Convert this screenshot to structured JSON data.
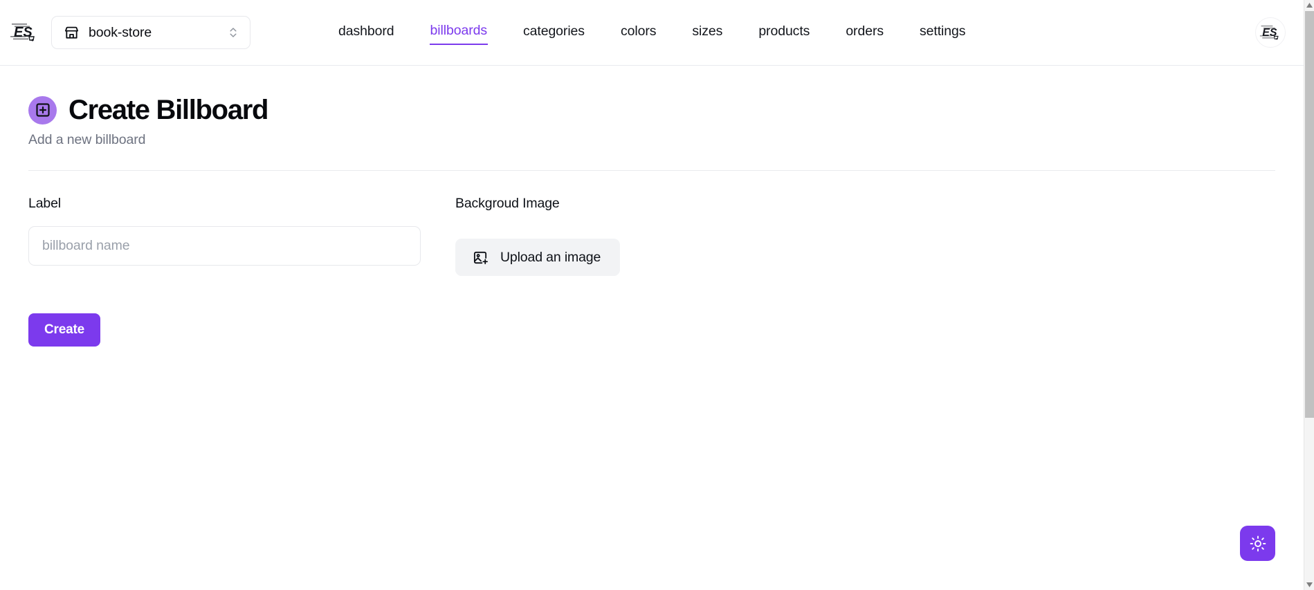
{
  "navbar": {
    "brand_logo_alt": "ES store logo",
    "store_switcher": {
      "store_name": "book-store",
      "icon": "store-icon",
      "chevron_icon": "chevrons-up-down-icon"
    },
    "links": [
      {
        "label": "dashbord",
        "active": false
      },
      {
        "label": "billboards",
        "active": true
      },
      {
        "label": "categories",
        "active": false
      },
      {
        "label": "colors",
        "active": false
      },
      {
        "label": "sizes",
        "active": false
      },
      {
        "label": "products",
        "active": false
      },
      {
        "label": "orders",
        "active": false
      },
      {
        "label": "settings",
        "active": false
      }
    ],
    "avatar_alt": "ES user avatar",
    "active_color": "#7c3aed"
  },
  "page": {
    "badge_icon": "square-plus-icon",
    "badge_color": "#a879ec",
    "title": "Create Billboard",
    "subtitle": "Add a new billboard"
  },
  "form": {
    "label_field": {
      "label": "Label",
      "value": "",
      "placeholder": "billboard name"
    },
    "image_field": {
      "label": "Backgroud Image",
      "upload_button_label": "Upload an image",
      "upload_icon": "image-plus-icon"
    },
    "submit_label": "Create",
    "submit_color": "#7c3aed"
  },
  "theme_toggle": {
    "icon": "sun-icon",
    "color": "#7c3aed",
    "label": "Toggle theme"
  },
  "scrollbar": {
    "up_icon": "scroll-up-arrow-icon",
    "down_icon": "scroll-down-arrow-icon"
  }
}
